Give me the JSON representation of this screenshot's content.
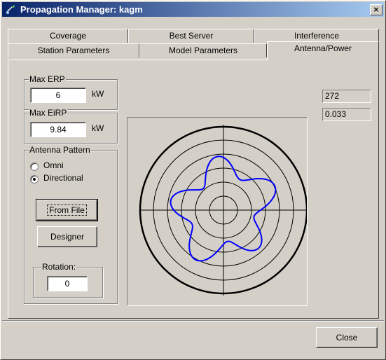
{
  "window": {
    "title": "Propagation Manager: kagm",
    "close_glyph": "×"
  },
  "tabs_back": [
    "Coverage",
    "Best Server",
    "Interference"
  ],
  "tabs_front": [
    "Station Parameters",
    "Model Parameters",
    "Antenna/Power"
  ],
  "active_tab": "Antenna/Power",
  "max_erp": {
    "label": "Max ERP",
    "value": "6",
    "unit": "kW"
  },
  "max_eirp": {
    "label": "Max EiRP",
    "value": "9.84",
    "unit": "kW"
  },
  "antenna_pattern": {
    "label": "Antenna Pattern",
    "options": [
      {
        "label": "Omni",
        "selected": false
      },
      {
        "label": "Directional",
        "selected": true
      }
    ],
    "from_file_label": "From File",
    "designer_label": "Designer"
  },
  "rotation": {
    "label": "Rotation:",
    "value": "0"
  },
  "readouts": {
    "top": "272",
    "bottom": "0.033"
  },
  "pattern_color": "#0000ff",
  "close_label": "Close"
}
